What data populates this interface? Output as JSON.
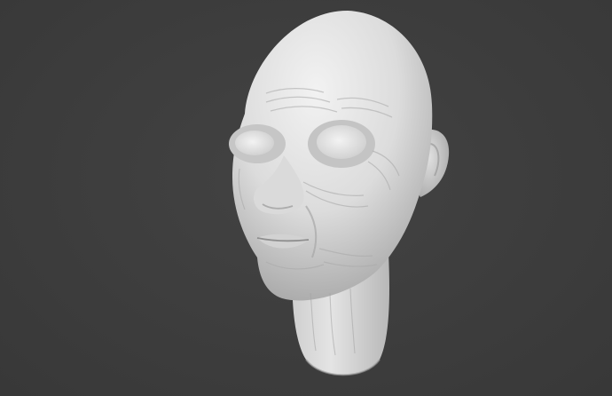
{
  "viewport": {
    "background_color": "#3d3d3d",
    "subject": "sculpt-head-icon",
    "material_color": "#e6e6e6",
    "shadow_color": "#9a9a9a"
  }
}
